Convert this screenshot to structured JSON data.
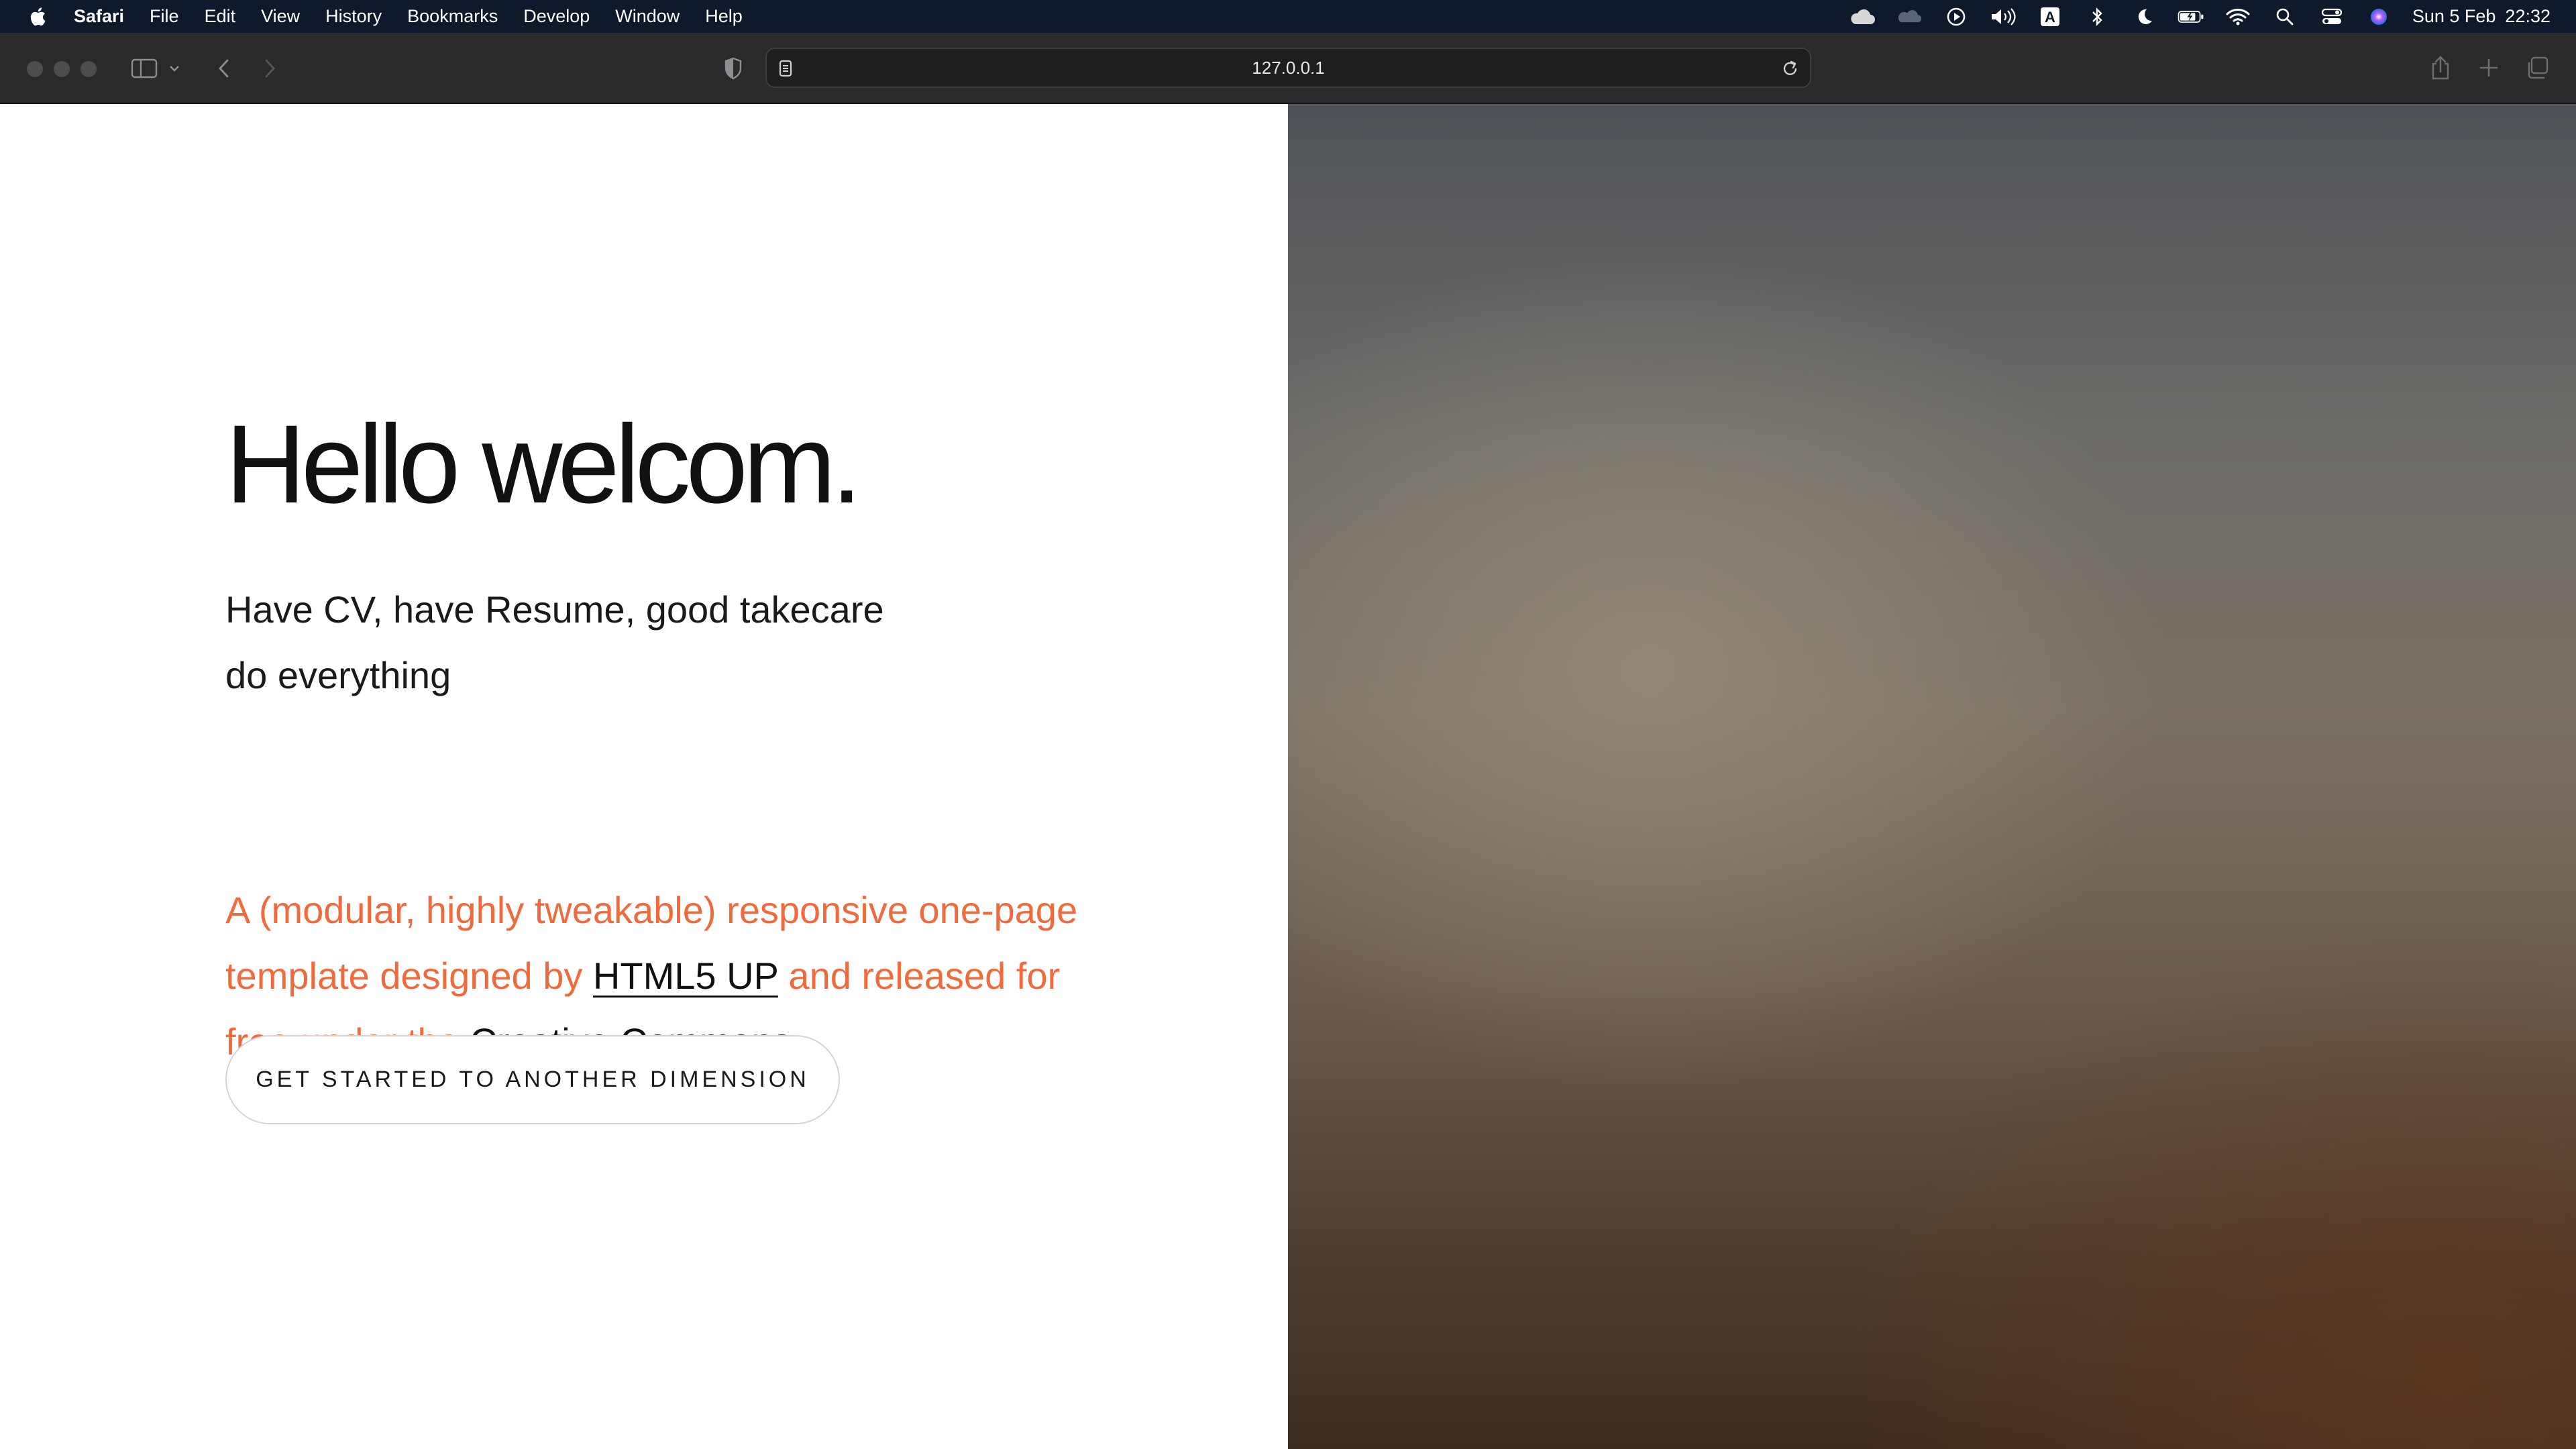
{
  "menubar": {
    "app_name": "Safari",
    "menus": [
      "File",
      "Edit",
      "View",
      "History",
      "Bookmarks",
      "Develop",
      "Window",
      "Help"
    ],
    "status_icons": [
      "cloud-icon",
      "onedrive-icon",
      "play-circle-icon",
      "volume-icon",
      "keyboard-input-icon",
      "bluetooth-icon",
      "moon-icon",
      "battery-icon",
      "wifi-icon",
      "spotlight-search-icon",
      "control-center-icon",
      "siri-icon"
    ],
    "input_source_letter": "A",
    "date": "Sun 5 Feb",
    "time": "22:32"
  },
  "browser": {
    "url": "127.0.0.1"
  },
  "hero": {
    "title": "Hello welcom.",
    "subtitle": "Have CV, have Resume, good takecare do everything",
    "desc_part1": "A (modular, highly tweakable) responsive one-page template designed by ",
    "link1": "HTML5 UP",
    "desc_part2": " and released for free under the ",
    "link2": "Creative Commons",
    "desc_part3": ".",
    "cta_label": "GET STARTED TO ANOTHER DIMENSION"
  },
  "colors": {
    "menubar_bg": "#0e1a2b",
    "toolbar_bg": "#2a2a2c",
    "accent": "#f06a3c",
    "text": "#111111"
  }
}
